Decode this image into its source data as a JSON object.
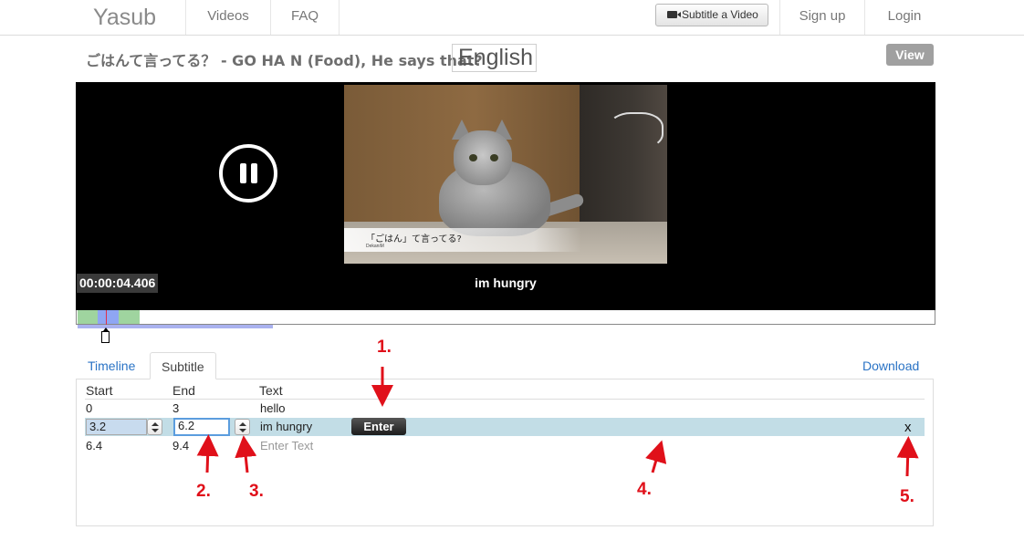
{
  "nav": {
    "brand": "Yasub",
    "videos": "Videos",
    "faq": "FAQ",
    "subtitle_button": "Subtitle a Video",
    "signup": "Sign up",
    "login": "Login"
  },
  "video": {
    "title": "ごはんて言ってる？ - GO HA N (Food), He says that?",
    "language": "English",
    "view_button": "View",
    "timecode": "00:00:04.406",
    "current_subtitle": "im hungry",
    "burned_caption": "「ごはん」て言ってる?",
    "burned_credit": "DekaniM"
  },
  "tabs": {
    "timeline": "Timeline",
    "subtitle": "Subtitle",
    "download": "Download"
  },
  "table": {
    "headers": {
      "start": "Start",
      "end": "End",
      "text": "Text"
    },
    "rows": [
      {
        "start": "0",
        "end": "3",
        "text": "hello"
      },
      {
        "start": "3.2",
        "end": "6.2",
        "text": "im hungry"
      },
      {
        "start": "6.4",
        "end": "9.4",
        "text": ""
      }
    ],
    "text_placeholder": "Enter Text",
    "enter_button": "Enter",
    "delete_label": "x"
  },
  "annotations": [
    "1.",
    "2.",
    "3.",
    "4.",
    "5."
  ],
  "colors": {
    "annotation": "#e0101a",
    "active_row": "#c2dde6",
    "link": "#2a73c5"
  }
}
